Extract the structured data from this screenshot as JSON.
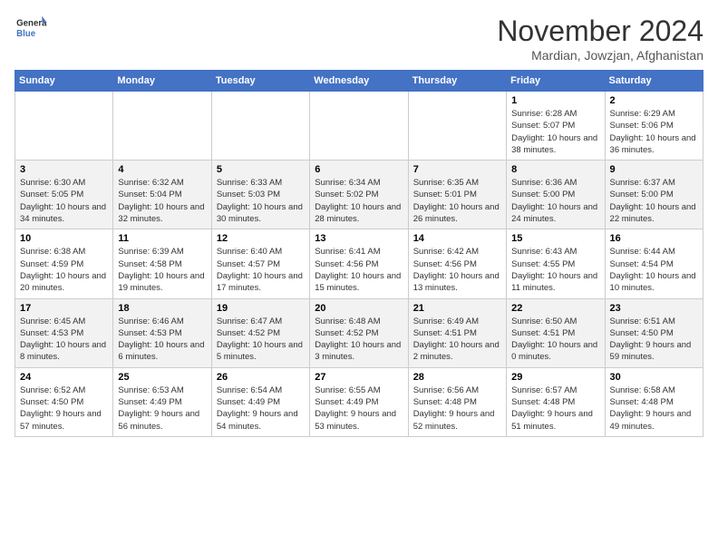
{
  "header": {
    "logo_line1": "General",
    "logo_line2": "Blue",
    "month_title": "November 2024",
    "location": "Mardian, Jowzjan, Afghanistan"
  },
  "days_of_week": [
    "Sunday",
    "Monday",
    "Tuesday",
    "Wednesday",
    "Thursday",
    "Friday",
    "Saturday"
  ],
  "weeks": [
    [
      {
        "day": "",
        "info": ""
      },
      {
        "day": "",
        "info": ""
      },
      {
        "day": "",
        "info": ""
      },
      {
        "day": "",
        "info": ""
      },
      {
        "day": "",
        "info": ""
      },
      {
        "day": "1",
        "info": "Sunrise: 6:28 AM\nSunset: 5:07 PM\nDaylight: 10 hours and 38 minutes."
      },
      {
        "day": "2",
        "info": "Sunrise: 6:29 AM\nSunset: 5:06 PM\nDaylight: 10 hours and 36 minutes."
      }
    ],
    [
      {
        "day": "3",
        "info": "Sunrise: 6:30 AM\nSunset: 5:05 PM\nDaylight: 10 hours and 34 minutes."
      },
      {
        "day": "4",
        "info": "Sunrise: 6:32 AM\nSunset: 5:04 PM\nDaylight: 10 hours and 32 minutes."
      },
      {
        "day": "5",
        "info": "Sunrise: 6:33 AM\nSunset: 5:03 PM\nDaylight: 10 hours and 30 minutes."
      },
      {
        "day": "6",
        "info": "Sunrise: 6:34 AM\nSunset: 5:02 PM\nDaylight: 10 hours and 28 minutes."
      },
      {
        "day": "7",
        "info": "Sunrise: 6:35 AM\nSunset: 5:01 PM\nDaylight: 10 hours and 26 minutes."
      },
      {
        "day": "8",
        "info": "Sunrise: 6:36 AM\nSunset: 5:00 PM\nDaylight: 10 hours and 24 minutes."
      },
      {
        "day": "9",
        "info": "Sunrise: 6:37 AM\nSunset: 5:00 PM\nDaylight: 10 hours and 22 minutes."
      }
    ],
    [
      {
        "day": "10",
        "info": "Sunrise: 6:38 AM\nSunset: 4:59 PM\nDaylight: 10 hours and 20 minutes."
      },
      {
        "day": "11",
        "info": "Sunrise: 6:39 AM\nSunset: 4:58 PM\nDaylight: 10 hours and 19 minutes."
      },
      {
        "day": "12",
        "info": "Sunrise: 6:40 AM\nSunset: 4:57 PM\nDaylight: 10 hours and 17 minutes."
      },
      {
        "day": "13",
        "info": "Sunrise: 6:41 AM\nSunset: 4:56 PM\nDaylight: 10 hours and 15 minutes."
      },
      {
        "day": "14",
        "info": "Sunrise: 6:42 AM\nSunset: 4:56 PM\nDaylight: 10 hours and 13 minutes."
      },
      {
        "day": "15",
        "info": "Sunrise: 6:43 AM\nSunset: 4:55 PM\nDaylight: 10 hours and 11 minutes."
      },
      {
        "day": "16",
        "info": "Sunrise: 6:44 AM\nSunset: 4:54 PM\nDaylight: 10 hours and 10 minutes."
      }
    ],
    [
      {
        "day": "17",
        "info": "Sunrise: 6:45 AM\nSunset: 4:53 PM\nDaylight: 10 hours and 8 minutes."
      },
      {
        "day": "18",
        "info": "Sunrise: 6:46 AM\nSunset: 4:53 PM\nDaylight: 10 hours and 6 minutes."
      },
      {
        "day": "19",
        "info": "Sunrise: 6:47 AM\nSunset: 4:52 PM\nDaylight: 10 hours and 5 minutes."
      },
      {
        "day": "20",
        "info": "Sunrise: 6:48 AM\nSunset: 4:52 PM\nDaylight: 10 hours and 3 minutes."
      },
      {
        "day": "21",
        "info": "Sunrise: 6:49 AM\nSunset: 4:51 PM\nDaylight: 10 hours and 2 minutes."
      },
      {
        "day": "22",
        "info": "Sunrise: 6:50 AM\nSunset: 4:51 PM\nDaylight: 10 hours and 0 minutes."
      },
      {
        "day": "23",
        "info": "Sunrise: 6:51 AM\nSunset: 4:50 PM\nDaylight: 9 hours and 59 minutes."
      }
    ],
    [
      {
        "day": "24",
        "info": "Sunrise: 6:52 AM\nSunset: 4:50 PM\nDaylight: 9 hours and 57 minutes."
      },
      {
        "day": "25",
        "info": "Sunrise: 6:53 AM\nSunset: 4:49 PM\nDaylight: 9 hours and 56 minutes."
      },
      {
        "day": "26",
        "info": "Sunrise: 6:54 AM\nSunset: 4:49 PM\nDaylight: 9 hours and 54 minutes."
      },
      {
        "day": "27",
        "info": "Sunrise: 6:55 AM\nSunset: 4:49 PM\nDaylight: 9 hours and 53 minutes."
      },
      {
        "day": "28",
        "info": "Sunrise: 6:56 AM\nSunset: 4:48 PM\nDaylight: 9 hours and 52 minutes."
      },
      {
        "day": "29",
        "info": "Sunrise: 6:57 AM\nSunset: 4:48 PM\nDaylight: 9 hours and 51 minutes."
      },
      {
        "day": "30",
        "info": "Sunrise: 6:58 AM\nSunset: 4:48 PM\nDaylight: 9 hours and 49 minutes."
      }
    ]
  ]
}
